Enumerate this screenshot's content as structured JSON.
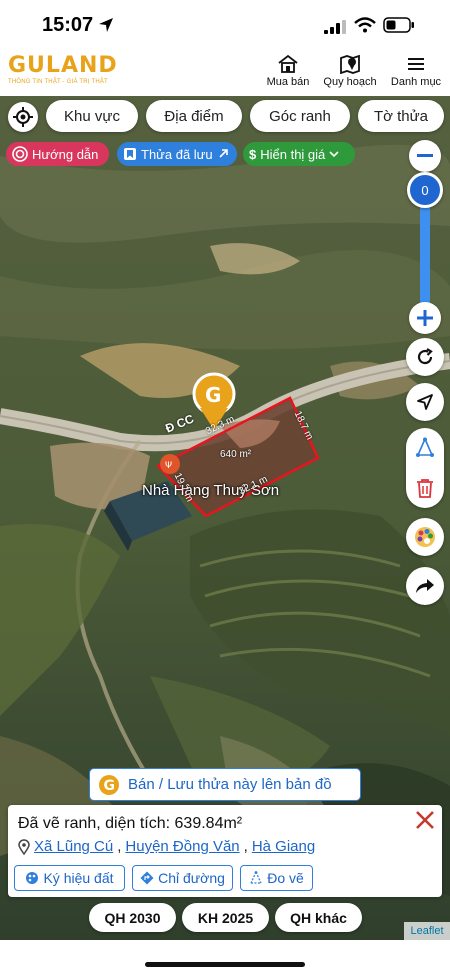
{
  "status_bar": {
    "time": "15:07"
  },
  "header": {
    "logo_text": "GULAND",
    "logo_tagline": "THÔNG TIN THẬT - GIÁ TRỊ THẬT",
    "nav": [
      {
        "label": "Mua bán",
        "icon": "house-icon"
      },
      {
        "label": "Quy hoạch",
        "icon": "map-pin-icon"
      },
      {
        "label": "Danh mục",
        "icon": "hamburger-icon"
      }
    ]
  },
  "filters": {
    "chips": [
      "Khu vực",
      "Địa điểm",
      "Góc ranh",
      "Tờ thửa"
    ],
    "pills": {
      "guide": "Hướng dẫn",
      "saved": "Thửa đã lưu",
      "price": "Hiển thị giá"
    }
  },
  "map_controls": {
    "zoom_level": "0"
  },
  "map_labels": {
    "road": "Đ CC",
    "place": "Nhà Hàng Thuý Sơn",
    "area": "640 m²",
    "edges": [
      "32.3 m",
      "18.7 m",
      "32.1 m",
      "19.7 m"
    ]
  },
  "colors": {
    "accent": "#2f7fdc",
    "brand": "#e8a31a",
    "parcel_outline": "#e8141e",
    "guide_pill": "#d9365d",
    "price_pill": "#2e9a3c"
  },
  "bottom": {
    "save_banner": "Bán / Lưu thửa này lên bản đồ",
    "info_title": "Đã vẽ ranh, diện tích: 639.84m²",
    "address": {
      "commune": "Xã Lũng Cú",
      "district": "Huyện Đồng Văn",
      "province": "Hà Giang",
      "sep": ","
    },
    "actions": [
      "Ký hiệu đất",
      "Chỉ đường",
      "Đo vẽ"
    ],
    "plans": [
      "QH 2030",
      "KH 2025",
      "QH khác"
    ],
    "attribution": "Leaflet"
  }
}
